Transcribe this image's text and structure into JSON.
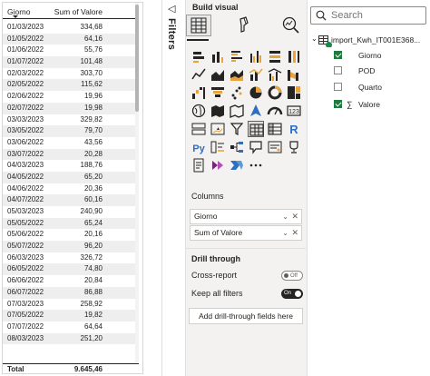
{
  "table": {
    "headers": {
      "col1": "Giorno",
      "col2": "Sum of Valore"
    },
    "rows": [
      {
        "giorno": "01/03/2023",
        "valore": "334,68"
      },
      {
        "giorno": "01/05/2022",
        "valore": "64,16"
      },
      {
        "giorno": "01/06/2022",
        "valore": "55,76"
      },
      {
        "giorno": "01/07/2022",
        "valore": "101,48"
      },
      {
        "giorno": "02/03/2022",
        "valore": "303,70"
      },
      {
        "giorno": "02/05/2022",
        "valore": "115,62"
      },
      {
        "giorno": "02/06/2022",
        "valore": "19,96"
      },
      {
        "giorno": "02/07/2022",
        "valore": "19,98"
      },
      {
        "giorno": "03/03/2023",
        "valore": "329,82"
      },
      {
        "giorno": "03/05/2022",
        "valore": "79,70"
      },
      {
        "giorno": "03/06/2022",
        "valore": "43,56"
      },
      {
        "giorno": "03/07/2022",
        "valore": "20,28"
      },
      {
        "giorno": "04/03/2023",
        "valore": "188,76"
      },
      {
        "giorno": "04/05/2022",
        "valore": "65,20"
      },
      {
        "giorno": "04/06/2022",
        "valore": "20,36"
      },
      {
        "giorno": "04/07/2022",
        "valore": "60,16"
      },
      {
        "giorno": "05/03/2023",
        "valore": "240,90"
      },
      {
        "giorno": "05/05/2022",
        "valore": "65,24"
      },
      {
        "giorno": "05/06/2022",
        "valore": "20,16"
      },
      {
        "giorno": "05/07/2022",
        "valore": "96,20"
      },
      {
        "giorno": "06/03/2023",
        "valore": "326,72"
      },
      {
        "giorno": "06/05/2022",
        "valore": "74,80"
      },
      {
        "giorno": "06/06/2022",
        "valore": "20,84"
      },
      {
        "giorno": "06/07/2022",
        "valore": "86,88"
      },
      {
        "giorno": "07/03/2023",
        "valore": "258,92"
      },
      {
        "giorno": "07/05/2022",
        "valore": "19,82"
      },
      {
        "giorno": "07/07/2022",
        "valore": "64,64"
      },
      {
        "giorno": "08/03/2023",
        "valore": "251,20"
      }
    ],
    "total_label": "Total",
    "total_value": "9.645,46"
  },
  "filters": {
    "label": "Filters",
    "icon": "chevron-left-icon"
  },
  "viz": {
    "title": "Build visual",
    "tab_icons": [
      "visual-grid-icon",
      "format-brush-icon",
      "analytics-magnifier-icon"
    ],
    "grid_icons": [
      "stacked-bar-icon",
      "stacked-column-icon",
      "clustered-bar-icon",
      "clustered-column-icon",
      "100-bar-icon",
      "100-column-icon",
      "line-chart-icon",
      "area-chart-icon",
      "stacked-area-icon",
      "line-column-icon",
      "line-clustered-icon",
      "ribbon-chart-icon",
      "waterfall-icon",
      "funnel-icon",
      "scatter-icon",
      "pie-icon",
      "donut-icon",
      "treemap-icon",
      "map-icon",
      "filled-map-icon",
      "shape-map-icon",
      "azure-map-icon",
      "gauge-icon",
      "card-icon",
      "multi-card-icon",
      "kpi-icon",
      "slicer-icon",
      "table-icon",
      "matrix-icon",
      "r-visual-icon",
      "python-visual-icon",
      "key-influencers-icon",
      "decomposition-tree-icon",
      "qa-icon",
      "smart-narrative-icon",
      "goals-icon",
      "paginated-report-icon",
      "power-apps-icon",
      "power-automate-icon",
      "more-visuals-icon"
    ],
    "columns_label": "Columns",
    "column_fields": [
      "Giorno",
      "Sum of Valore"
    ],
    "drill_through_label": "Drill through",
    "cross_report_label": "Cross-report",
    "cross_report_state": "Off",
    "keep_filters_label": "Keep all filters",
    "keep_filters_state": "On",
    "drill_placeholder": "Add drill-through fields here"
  },
  "data": {
    "search_placeholder": "Search",
    "table_name": "import_Kwh_IT001E368...",
    "fields": [
      {
        "name": "Giorno",
        "checked": true,
        "sigma": false
      },
      {
        "name": "POD",
        "checked": false,
        "sigma": false
      },
      {
        "name": "Quarto",
        "checked": false,
        "sigma": false
      },
      {
        "name": "Valore",
        "checked": true,
        "sigma": true
      }
    ]
  },
  "colors": {
    "accent_green": "#1f7a3d",
    "dot_green": "#118d44",
    "pane_bg": "#f3f2f1"
  }
}
